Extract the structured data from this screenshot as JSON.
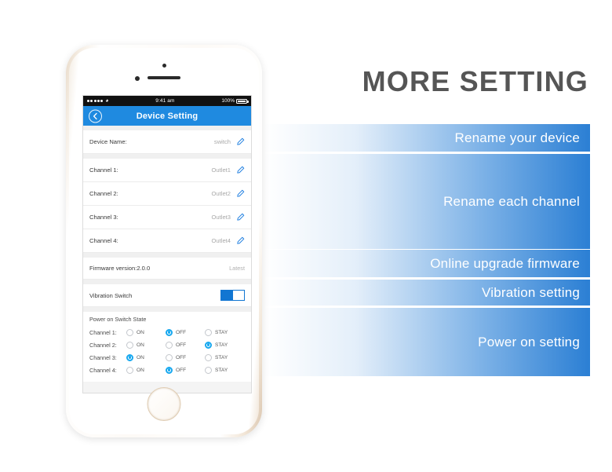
{
  "headline": "MORE SETTING",
  "phone": {
    "status_bar": {
      "carrier_dots": 5,
      "wifi_icon": "wifi-icon",
      "time": "9:41 am",
      "battery_percent": "100%"
    },
    "nav": {
      "back_icon": "chevron-left-icon",
      "title": "Device Setting"
    },
    "rows": [
      {
        "label": "Device Name:",
        "value": "switch",
        "edit_icon": "pencil-icon"
      },
      {
        "label": "Channel 1:",
        "value": "Outlet1",
        "edit_icon": "pencil-icon"
      },
      {
        "label": "Channel 2:",
        "value": "Outlet2",
        "edit_icon": "pencil-icon"
      },
      {
        "label": "Channel 3:",
        "value": "Outlet3",
        "edit_icon": "pencil-icon"
      },
      {
        "label": "Channel 4:",
        "value": "Outlet4",
        "edit_icon": "pencil-icon"
      }
    ],
    "firmware": {
      "label": "Firmware version:2.0.0",
      "status": "Latest"
    },
    "vibration": {
      "label": "Vibration Switch",
      "state": "on"
    },
    "power_on": {
      "title": "Power on Switch State",
      "options": [
        "ON",
        "OFF",
        "STAY"
      ],
      "channels": [
        {
          "name": "Channel 1:",
          "selected": "OFF"
        },
        {
          "name": "Channel 2:",
          "selected": "STAY"
        },
        {
          "name": "Channel 3:",
          "selected": "ON"
        },
        {
          "name": "Channel 4:",
          "selected": "OFF"
        }
      ]
    }
  },
  "banners": [
    {
      "id": "rename-device",
      "label": "Rename your device"
    },
    {
      "id": "rename-channel",
      "label": "Rename each channel"
    },
    {
      "id": "upgrade",
      "label": "Online upgrade firmware"
    },
    {
      "id": "vibration",
      "label": "Vibration setting"
    },
    {
      "id": "power",
      "label": "Power on setting"
    }
  ],
  "colors": {
    "accent_blue": "#1f8ae0",
    "banner_blue": "#2b7fd4",
    "radio_blue": "#17a8ef",
    "headline_gray": "#555555",
    "bezel_gold": "#e0cdb4"
  }
}
